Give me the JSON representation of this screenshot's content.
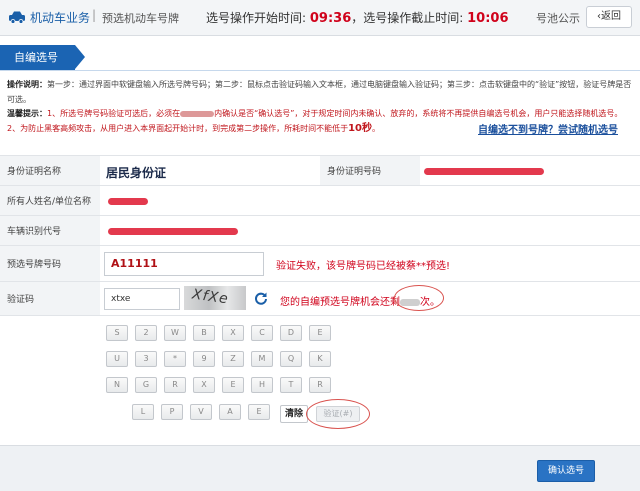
{
  "topbar": {
    "biz": "机动车业务",
    "sep": "|",
    "crumb": "预选机动车号牌",
    "start_label": "选号操作开始时间: ",
    "start_time": "09:36",
    "end_label": "，选号操作截止时间: ",
    "end_time": "10:06",
    "pool": "号池公示",
    "back": "返回"
  },
  "ribbon": {
    "label": "自编选号"
  },
  "instructions": {
    "title": "操作说明：",
    "text": "第一步：通过界面中软键盘输入所选号牌号码；第二步：鼠标点击验证码输入文本框，通过电脑键盘输入验证码；第三步：点击软键盘中的“验证”按钮，验证号牌是否可选。"
  },
  "tips": {
    "title": "温馨提示：",
    "text1": "1、所选号牌号码验证可选后，必须在",
    "text2": "内确认是否“确认选号”，对于规定时间内未确认、放弃的，系统将不再提供自编选号机会，用户只能选择随机选号。2、为防止黑客高频攻击，从用户进入本界面起开始计时，到完成第二步操作，所耗时间不能低于",
    "big": "10秒",
    "end": "。"
  },
  "random_link": "自编选不到号牌？尝试随机选号",
  "form": {
    "id_type_label": "身份证明名称",
    "id_type_value": "居民身份证",
    "id_no_label": "身份证明号码",
    "owner_label": "所有人姓名/单位名称",
    "vin_label": "车辆识别代号",
    "plate_label": "预选号牌号码",
    "plate_value": "A11111",
    "fail_msg": "验证失败，该号牌号码已经被蔡**预选!",
    "code_label": "验证码",
    "code_value": "xtxe",
    "captcha_text": "XfXe",
    "remain_msg": "您的自编预选号牌机会还剩",
    "remain_end": "次。"
  },
  "keypad": {
    "rows": [
      [
        "S",
        "2",
        "W",
        "B",
        "X",
        "C",
        "D",
        "E"
      ],
      [
        "U",
        "3",
        "*",
        "9",
        "Z",
        "M",
        "Q",
        "K"
      ],
      [
        "N",
        "G",
        "R",
        "X",
        "E",
        "H",
        "T",
        "R"
      ],
      [
        "L",
        "P",
        "V",
        "A",
        "E"
      ]
    ],
    "clear": "清除",
    "verify": "验证(#)"
  },
  "footer": {
    "confirm": "确认选号"
  }
}
